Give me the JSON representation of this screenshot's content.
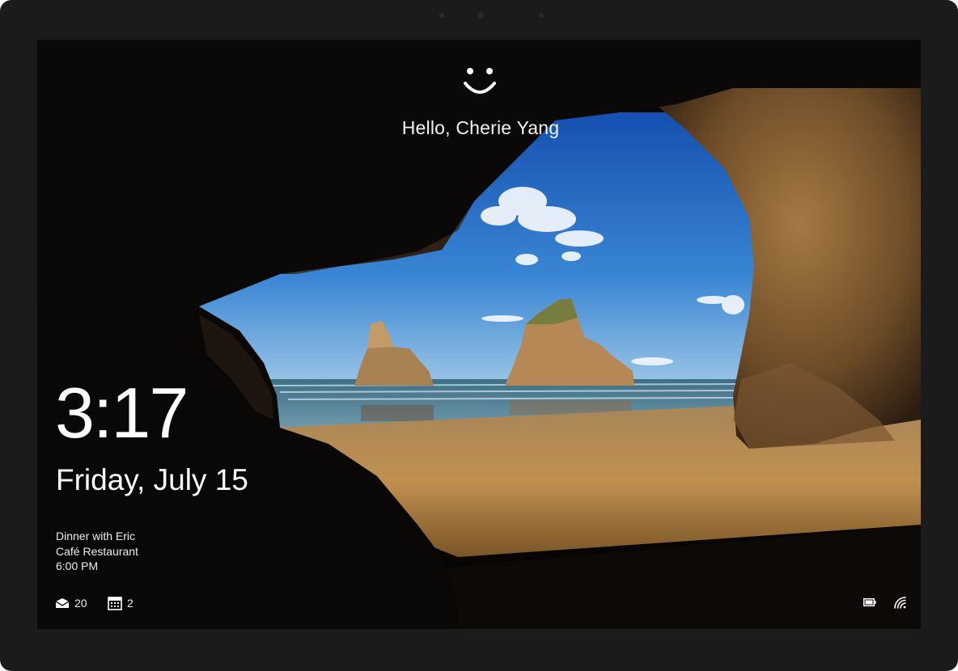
{
  "lock_screen": {
    "greeting": "Hello, Cherie Yang",
    "time": "3:17",
    "date": "Friday, July 15",
    "event": {
      "title": "Dinner with Eric",
      "location": "Café Restaurant",
      "time": "6:00 PM"
    },
    "badges": {
      "mail": {
        "icon": "mail-icon",
        "count": "20"
      },
      "calendar": {
        "icon": "calendar-icon",
        "count": "2"
      }
    },
    "status": {
      "battery_icon": "battery-icon",
      "wifi_icon": "wifi-icon"
    },
    "signin_icon": "windows-hello-face-icon"
  },
  "colors": {
    "bezel": "#1b1b1b",
    "sky": "#2a6fc4",
    "sand": "#b78a4c",
    "text": "#ffffff"
  }
}
